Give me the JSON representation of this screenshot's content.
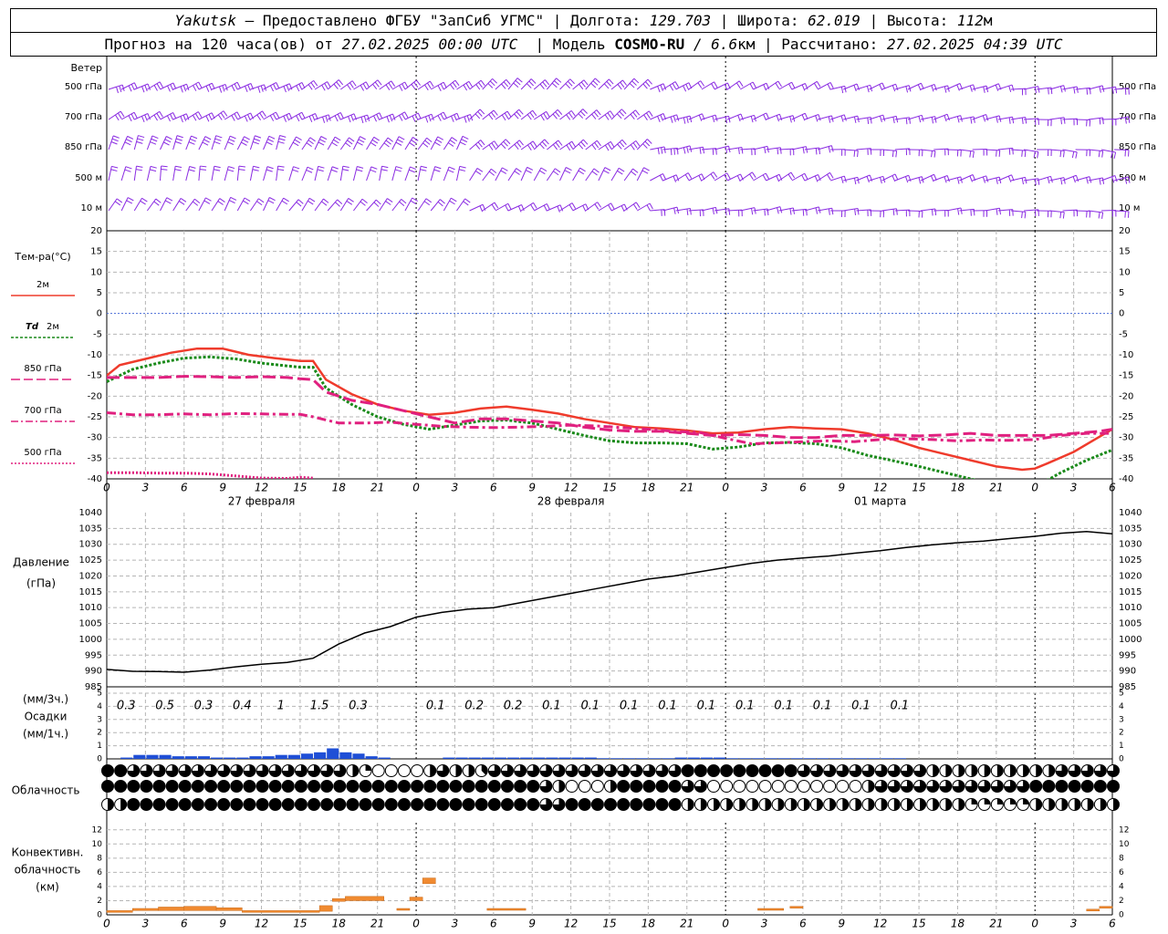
{
  "header": {
    "station": "Yakutsk",
    "provided_by": " – Предоставлено ФГБУ \"ЗапСиб УГМС\" | ",
    "lon_label": "Долгота: ",
    "lon_value": "129.703",
    "lat_label": " | Широта: ",
    "lat_value": "62.019",
    "alt_label": " | Высота: ",
    "alt_value": "112",
    "alt_unit": "м",
    "forecast_label": "Прогноз на 120 часа(ов) от ",
    "forecast_time": "27.02.2025 00:00 UTC",
    "model_label": "  | Модель ",
    "model_name": "COSMO-RU",
    "model_sep": " / ",
    "model_res": "6.6",
    "model_res_unit": "км",
    "calc_label": " | Рассчитано: ",
    "calc_time": "27.02.2025 04:39 UTC"
  },
  "chart_data": [
    {
      "type": "line",
      "panel": "wind",
      "ylabel": "Ветер",
      "levels": [
        "500 гПа",
        "700 гПа",
        "850 гПа",
        "500 м",
        "10 м"
      ],
      "barb_color": "#8a2be2"
    },
    {
      "type": "line",
      "panel": "temperature",
      "ylabel": "Тем-ра(°C)",
      "ylim": [
        -40,
        20
      ],
      "yticks": [
        20,
        15,
        10,
        5,
        0,
        -5,
        -10,
        -15,
        -20,
        -25,
        -30,
        -35,
        -40
      ],
      "x_hour_labels": [
        "0",
        "3",
        "6",
        "9",
        "12",
        "15",
        "18",
        "21",
        "0",
        "3",
        "6",
        "9",
        "12",
        "15",
        "18",
        "21",
        "0",
        "3",
        "6",
        "9",
        "12",
        "15",
        "18",
        "21",
        "0",
        "3",
        "6"
      ],
      "day_labels": [
        "27 февраля",
        "28 февраля",
        "01 марта"
      ],
      "x_range_hours": [
        0,
        78
      ],
      "series": [
        {
          "name": "2м",
          "color": "#ef3b2c",
          "x": [
            0,
            1,
            3,
            5,
            7,
            9,
            11,
            13,
            15,
            16,
            17,
            19,
            21,
            23,
            25,
            27,
            29,
            31,
            33,
            35,
            37,
            39,
            41,
            43,
            45,
            47,
            49,
            51,
            53,
            55,
            57,
            59,
            61,
            63,
            65,
            67,
            69,
            71,
            72,
            73,
            75,
            77,
            78
          ],
          "values": [
            -15,
            -12.5,
            -11,
            -9.5,
            -8.5,
            -8.5,
            -10,
            -10.8,
            -11.5,
            -11.5,
            -16,
            -19.5,
            -22,
            -23.5,
            -24.5,
            -24,
            -23,
            -22.5,
            -23.3,
            -24.2,
            -25.5,
            -26.5,
            -27.5,
            -27.8,
            -28.3,
            -29,
            -28.8,
            -28,
            -27.5,
            -27.8,
            -28,
            -29,
            -30.5,
            -32.5,
            -34,
            -35.5,
            -37,
            -37.8,
            -37.5,
            -36.2,
            -33.5,
            -29.8,
            -28
          ]
        },
        {
          "name": "Td 2м",
          "color": "#1a8a1a",
          "x": [
            0,
            2,
            4,
            6,
            8,
            10,
            12,
            14,
            15,
            16,
            17,
            19,
            21,
            23,
            25,
            27,
            29,
            31,
            33,
            35,
            37,
            39,
            41,
            43,
            45,
            47,
            49,
            51,
            53,
            55,
            57,
            59,
            61,
            63,
            65,
            67,
            69,
            71,
            72,
            74,
            76,
            78
          ],
          "values": [
            -16.5,
            -13.5,
            -12,
            -10.8,
            -10.5,
            -11,
            -12,
            -12.7,
            -13,
            -13,
            -18,
            -22,
            -25,
            -26.8,
            -28,
            -27,
            -26,
            -25.8,
            -26.5,
            -28,
            -29.5,
            -30.8,
            -31.3,
            -31.3,
            -31.5,
            -32.8,
            -32.3,
            -31.3,
            -31.2,
            -31.5,
            -32.5,
            -34.3,
            -35.6,
            -37,
            -38.5,
            -40,
            -41.5,
            -42.5,
            -42,
            -38.5,
            -35.5,
            -33
          ]
        },
        {
          "name": "850 гПа",
          "color": "#e0207f",
          "x": [
            0,
            2,
            4,
            6,
            8,
            10,
            12,
            14,
            15,
            16,
            17,
            19,
            21,
            23,
            25,
            27,
            29,
            31,
            33,
            35,
            37,
            39,
            41,
            43,
            45,
            47,
            49,
            51,
            53,
            55,
            57,
            59,
            61,
            63,
            65,
            67,
            69,
            71,
            73,
            75,
            77,
            78
          ],
          "values": [
            -15.5,
            -15.5,
            -15.5,
            -15.2,
            -15.3,
            -15.5,
            -15.3,
            -15.5,
            -15.8,
            -16,
            -19,
            -21,
            -22,
            -23.5,
            -25,
            -26.5,
            -25.5,
            -25.5,
            -26,
            -26.5,
            -27.5,
            -28.2,
            -28.5,
            -28.5,
            -29,
            -29.5,
            -29.3,
            -29.5,
            -30,
            -30,
            -29.5,
            -29.5,
            -29.4,
            -29.6,
            -29.4,
            -29,
            -29.5,
            -29.5,
            -29.5,
            -29,
            -28.5,
            -28
          ]
        },
        {
          "name": "700 гПа",
          "color": "#e0207f",
          "x": [
            0,
            2,
            4,
            6,
            8,
            10,
            12,
            14,
            15,
            16,
            18,
            20,
            22,
            24,
            26,
            28,
            30,
            32,
            34,
            36,
            38,
            40,
            42,
            44,
            46,
            48,
            50,
            52,
            54,
            56,
            58,
            60,
            62,
            64,
            66,
            68,
            70,
            72,
            74,
            76,
            78
          ],
          "values": [
            -24,
            -24.5,
            -24.5,
            -24.3,
            -24.5,
            -24.2,
            -24.3,
            -24.4,
            -24.4,
            -25,
            -26.5,
            -26.5,
            -26.3,
            -26.8,
            -27.3,
            -27.5,
            -27.6,
            -27.5,
            -27.3,
            -27,
            -27.2,
            -27.6,
            -28,
            -28.5,
            -28.8,
            -30.2,
            -31.5,
            -31.3,
            -31,
            -30.8,
            -31,
            -30.5,
            -30.3,
            -30.5,
            -30.8,
            -30.6,
            -30.7,
            -30.5,
            -29.5,
            -29,
            -29
          ]
        },
        {
          "name": "500 гПа",
          "color": "#e0207f",
          "x": [
            0,
            2,
            4,
            6,
            8,
            10,
            12,
            14,
            15,
            16
          ],
          "values": [
            -38.5,
            -38.5,
            -38.6,
            -38.6,
            -38.8,
            -39.3,
            -39.8,
            -39.9,
            -39.6,
            -39.8
          ]
        }
      ]
    },
    {
      "type": "line",
      "panel": "pressure",
      "ylabel": "Давление",
      "yunit": "(гПа)",
      "ylim": [
        985,
        1040
      ],
      "yticks": [
        1040,
        1035,
        1030,
        1025,
        1020,
        1015,
        1010,
        1005,
        1000,
        995,
        990,
        985
      ],
      "series": [
        {
          "name": "Давление",
          "color": "#000000",
          "x": [
            0,
            2,
            4,
            6,
            8,
            10,
            12,
            14,
            16,
            18,
            20,
            22,
            24,
            26,
            28,
            30,
            32,
            34,
            36,
            38,
            40,
            42,
            44,
            46,
            48,
            50,
            52,
            54,
            56,
            58,
            60,
            62,
            64,
            66,
            68,
            70,
            72,
            74,
            76,
            78
          ],
          "values": [
            990.5,
            989.9,
            989.8,
            989.6,
            990.3,
            991.3,
            992.1,
            992.7,
            994,
            998.5,
            1002,
            1004,
            1007,
            1008.5,
            1009.5,
            1010,
            1011.5,
            1013,
            1014.5,
            1016,
            1017.5,
            1019,
            1020,
            1021.3,
            1022.7,
            1024,
            1025,
            1025.7,
            1026.3,
            1027.2,
            1028,
            1029,
            1029.8,
            1030.5,
            1031,
            1031.8,
            1032.5,
            1033.5,
            1034,
            1033.3
          ]
        }
      ]
    },
    {
      "type": "bar",
      "panel": "precipitation",
      "ylabel": "Осадки",
      "yunit_top": "(мм/3ч.)",
      "yunit_bottom": "(мм/1ч.)",
      "ylim": [
        0,
        5
      ],
      "yticks": [
        5,
        4,
        3,
        2,
        1,
        0
      ],
      "color": "#1f4fd6",
      "totals_3h": [
        {
          "x": 1.5,
          "label": "0.3"
        },
        {
          "x": 4.5,
          "label": "0.5"
        },
        {
          "x": 7.5,
          "label": "0.3"
        },
        {
          "x": 10.5,
          "label": "0.4"
        },
        {
          "x": 13.5,
          "label": "1"
        },
        {
          "x": 16.5,
          "label": "1.5"
        },
        {
          "x": 19.5,
          "label": "0.3"
        },
        {
          "x": 25.5,
          "label": "0.1"
        },
        {
          "x": 28.5,
          "label": "0.2"
        },
        {
          "x": 31.5,
          "label": "0.2"
        },
        {
          "x": 34.5,
          "label": "0.1"
        },
        {
          "x": 37.5,
          "label": "0.1"
        },
        {
          "x": 40.5,
          "label": "0.1"
        },
        {
          "x": 43.5,
          "label": "0.1"
        },
        {
          "x": 46.5,
          "label": "0.1"
        },
        {
          "x": 49.5,
          "label": "0.1"
        },
        {
          "x": 52.5,
          "label": "0.1"
        },
        {
          "x": 55.5,
          "label": "0.1"
        },
        {
          "x": 58.5,
          "label": "0.1"
        },
        {
          "x": 61.5,
          "label": "0.1"
        }
      ],
      "hourly_values": [
        0,
        0.1,
        0.3,
        0.3,
        0.3,
        0.2,
        0.2,
        0.2,
        0.1,
        0.1,
        0.1,
        0.2,
        0.2,
        0.3,
        0.3,
        0.4,
        0.5,
        0.8,
        0.5,
        0.4,
        0.2,
        0.1,
        0,
        0,
        0,
        0,
        0.1,
        0.1,
        0.1,
        0.1,
        0.1,
        0.1,
        0.1,
        0.1,
        0.1,
        0.1,
        0.1,
        0.1,
        0.05,
        0.05,
        0.05,
        0.05,
        0.05,
        0.05,
        0.1,
        0.1,
        0.1,
        0.1,
        0.05,
        0.05,
        0.05,
        0.05,
        0.05,
        0.05,
        0.05,
        0.05,
        0.05,
        0.05,
        0.05,
        0.05,
        0.05,
        0.05,
        0,
        0,
        0,
        0,
        0,
        0,
        0,
        0,
        0,
        0,
        0,
        0,
        0,
        0,
        0,
        0
      ]
    },
    {
      "type": "table",
      "panel": "cloudiness",
      "ylabel": "Облачность",
      "note": "three rows of cloud-cover symbols (eighths), hourly 0..78",
      "high": [
        8,
        8,
        6,
        6,
        6,
        6,
        6,
        6,
        6,
        6,
        6,
        6,
        6,
        6,
        6,
        6,
        6,
        6,
        6,
        4,
        2,
        0,
        0,
        0,
        0,
        4,
        6,
        4,
        4,
        3,
        6,
        6,
        6,
        6,
        6,
        6,
        6,
        6,
        6,
        6,
        6,
        6,
        6,
        6,
        6,
        8,
        8,
        8,
        8,
        8,
        8,
        8,
        8,
        8,
        6,
        6,
        6,
        6,
        6,
        6,
        6,
        6,
        6,
        6,
        4,
        4,
        4,
        4,
        4,
        4,
        4,
        4,
        4,
        4,
        6,
        6,
        6,
        6,
        6
      ],
      "middle": [
        8,
        8,
        8,
        8,
        8,
        8,
        8,
        8,
        8,
        8,
        8,
        8,
        8,
        8,
        8,
        8,
        8,
        8,
        8,
        8,
        8,
        8,
        8,
        8,
        8,
        8,
        8,
        8,
        8,
        8,
        8,
        8,
        8,
        8,
        6,
        4,
        0,
        0,
        0,
        4,
        8,
        8,
        8,
        8,
        8,
        6,
        6,
        0,
        0,
        0,
        0,
        0,
        0,
        0,
        0,
        0,
        0,
        0,
        0,
        4,
        6,
        6,
        6,
        6,
        6,
        6,
        6,
        6,
        6,
        6,
        6,
        6,
        8,
        8,
        8,
        8,
        8,
        8,
        8
      ],
      "low": [
        4,
        4,
        8,
        8,
        8,
        8,
        8,
        8,
        8,
        8,
        8,
        8,
        8,
        8,
        8,
        8,
        8,
        8,
        8,
        8,
        8,
        8,
        8,
        8,
        8,
        8,
        8,
        8,
        8,
        8,
        8,
        8,
        8,
        8,
        6,
        6,
        8,
        8,
        8,
        8,
        8,
        8,
        8,
        8,
        8,
        4,
        4,
        4,
        4,
        4,
        4,
        4,
        4,
        4,
        4,
        4,
        4,
        4,
        4,
        4,
        4,
        4,
        4,
        4,
        4,
        4,
        4,
        2,
        2,
        2,
        2,
        2,
        4,
        4,
        4,
        4,
        4,
        4,
        4
      ]
    },
    {
      "type": "bar",
      "panel": "convective",
      "ylabel_lines": [
        "Конвективн.",
        "облачность",
        "(км)"
      ],
      "ylim": [
        0,
        13
      ],
      "yticks": [
        12,
        10,
        8,
        6,
        4,
        2,
        0
      ],
      "color": "#f08a30",
      "segments": [
        {
          "x0": 0,
          "x1": 2,
          "bottom": 0.5,
          "top": 0.6
        },
        {
          "x0": 2,
          "x1": 4,
          "bottom": 0.6,
          "top": 0.9
        },
        {
          "x0": 4,
          "x1": 6,
          "bottom": 0.6,
          "top": 1.1
        },
        {
          "x0": 6,
          "x1": 8.5,
          "bottom": 0.6,
          "top": 1.2
        },
        {
          "x0": 8.5,
          "x1": 10.5,
          "bottom": 0.6,
          "top": 1.0
        },
        {
          "x0": 10.5,
          "x1": 16.5,
          "bottom": 0.5,
          "top": 0.6
        },
        {
          "x0": 16.5,
          "x1": 17.5,
          "bottom": 0.5,
          "top": 1.3
        },
        {
          "x0": 17.5,
          "x1": 18.5,
          "bottom": 1.9,
          "top": 2.3
        },
        {
          "x0": 18.5,
          "x1": 21.5,
          "bottom": 2.0,
          "top": 2.6
        },
        {
          "x0": 22.5,
          "x1": 23.5,
          "bottom": 0.8,
          "top": 0.9
        },
        {
          "x0": 23.5,
          "x1": 24.5,
          "bottom": 2.0,
          "top": 2.5
        },
        {
          "x0": 24.5,
          "x1": 25.5,
          "bottom": 4.4,
          "top": 5.2
        },
        {
          "x0": 29.5,
          "x1": 32.5,
          "bottom": 0.7,
          "top": 0.9
        },
        {
          "x0": 50.5,
          "x1": 52.5,
          "bottom": 0.7,
          "top": 0.9
        },
        {
          "x0": 53,
          "x1": 54,
          "bottom": 1.0,
          "top": 1.2
        },
        {
          "x0": 76,
          "x1": 77,
          "bottom": 0.6,
          "top": 0.8
        },
        {
          "x0": 77,
          "x1": 78,
          "bottom": 1.0,
          "top": 1.2
        }
      ]
    }
  ],
  "legend": {
    "t2m": "2м",
    "td_prefix": "Td",
    "td_suffix": " 2м",
    "t850": "850 гПа",
    "t700": "700 гПа",
    "t500": "500 гПа"
  }
}
